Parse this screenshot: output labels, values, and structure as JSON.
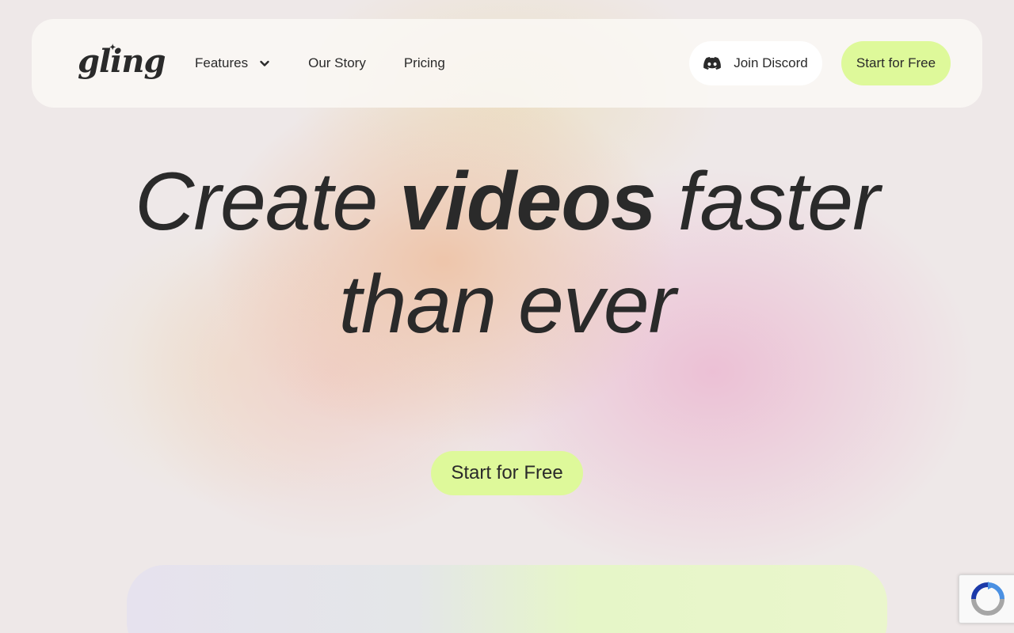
{
  "brand": {
    "logo_text": "gling"
  },
  "nav": {
    "items": [
      {
        "label": "Features",
        "has_dropdown": true
      },
      {
        "label": "Our Story"
      },
      {
        "label": "Pricing"
      }
    ],
    "discord_label": "Join Discord",
    "start_label": "Start for Free"
  },
  "hero": {
    "title_part1": "Create ",
    "title_strong": "videos",
    "title_part2": " faster",
    "title_line2": "than ever",
    "cta_label": "Start for Free"
  },
  "icons": {
    "dropdown": "chevron-down-icon",
    "discord": "discord-icon",
    "recaptcha": "recaptcha-icon"
  },
  "colors": {
    "accent": "#def99a",
    "text": "#2a2a2a",
    "navbar_bg": "#faf8f5"
  }
}
